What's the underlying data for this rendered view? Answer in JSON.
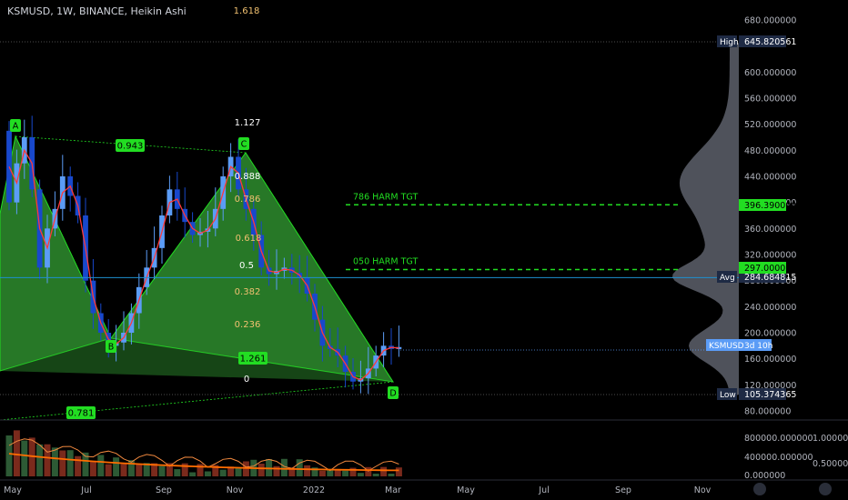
{
  "header": {
    "symbol_line": "KSMUSD, 1W, BINANCE, Heikin Ashi"
  },
  "chart_data": {
    "type": "candlestick",
    "title": "KSMUSD, 1W, BINANCE, Heikin Ashi",
    "y_axis": {
      "range": [
        70,
        700
      ],
      "ticks": [
        "680.000000",
        "600.000000",
        "560.000000",
        "520.000000",
        "480.000000",
        "440.000000",
        "400.000000",
        "360.000000",
        "320.000000",
        "280.000000",
        "240.000000",
        "200.000000",
        "160.000000",
        "120.000000",
        "80.000000"
      ]
    },
    "x_axis": {
      "labels": [
        "May",
        "Jul",
        "Sep",
        "Nov",
        "2022",
        "Mar",
        "May",
        "Jul",
        "Sep",
        "Nov"
      ]
    },
    "price_tags": {
      "high": {
        "label": "High",
        "value": "645.820561"
      },
      "avg": {
        "label": "Avg",
        "value": "284.684815"
      },
      "low": {
        "label": "Low",
        "value": "105.374365"
      },
      "current": {
        "label": "KSMUSD",
        "extra": "3d 10h"
      },
      "tgt786": "396.390099",
      "tgt050": "297.000000"
    },
    "fib_labels": [
      "1.618",
      "1.127",
      "0.888",
      "0.786",
      "0.618",
      "0.5",
      "0.382",
      "0.236",
      "0"
    ],
    "harmonic": {
      "points": [
        "A",
        "B",
        "C",
        "D"
      ],
      "ratios": [
        "0.943",
        "1.261",
        "0.781"
      ]
    },
    "target_lines": [
      {
        "label": "786 HARM TGT",
        "value": 396.39
      },
      {
        "label": "050 HARM TGT",
        "value": 297.0
      }
    ],
    "indicator_axis": {
      "left_ticks": [
        "800000.000000",
        "400000.000000",
        "0.000000"
      ],
      "right_ticks": [
        "1.000000",
        "0.500000"
      ]
    },
    "candles": [
      [
        510,
        400
      ],
      [
        400,
        460
      ],
      [
        460,
        500
      ],
      [
        500,
        420
      ],
      [
        420,
        300
      ],
      [
        300,
        360
      ],
      [
        360,
        390
      ],
      [
        390,
        440
      ],
      [
        440,
        410
      ],
      [
        410,
        380
      ],
      [
        380,
        280
      ],
      [
        280,
        230
      ],
      [
        230,
        200
      ],
      [
        200,
        180
      ],
      [
        180,
        185
      ],
      [
        185,
        200
      ],
      [
        200,
        230
      ],
      [
        230,
        270
      ],
      [
        270,
        300
      ],
      [
        300,
        330
      ],
      [
        330,
        380
      ],
      [
        380,
        420
      ],
      [
        420,
        390
      ],
      [
        390,
        370
      ],
      [
        370,
        350
      ],
      [
        350,
        355
      ],
      [
        355,
        360
      ],
      [
        360,
        390
      ],
      [
        390,
        440
      ],
      [
        440,
        470
      ],
      [
        470,
        420
      ],
      [
        420,
        390
      ],
      [
        390,
        350
      ],
      [
        350,
        300
      ],
      [
        300,
        290
      ],
      [
        290,
        295
      ],
      [
        295,
        300
      ],
      [
        300,
        292
      ],
      [
        292,
        285
      ],
      [
        285,
        260
      ],
      [
        260,
        220
      ],
      [
        220,
        180
      ],
      [
        180,
        175
      ],
      [
        175,
        165
      ],
      [
        165,
        140
      ],
      [
        140,
        125
      ],
      [
        125,
        130
      ],
      [
        130,
        145
      ],
      [
        145,
        165
      ],
      [
        165,
        180
      ],
      [
        180,
        175
      ],
      [
        175,
        178
      ]
    ],
    "colors": {
      "up": "#5b9cf6",
      "down": "#1848cc",
      "green": "#22dd22",
      "fib": "#f0c070"
    }
  }
}
